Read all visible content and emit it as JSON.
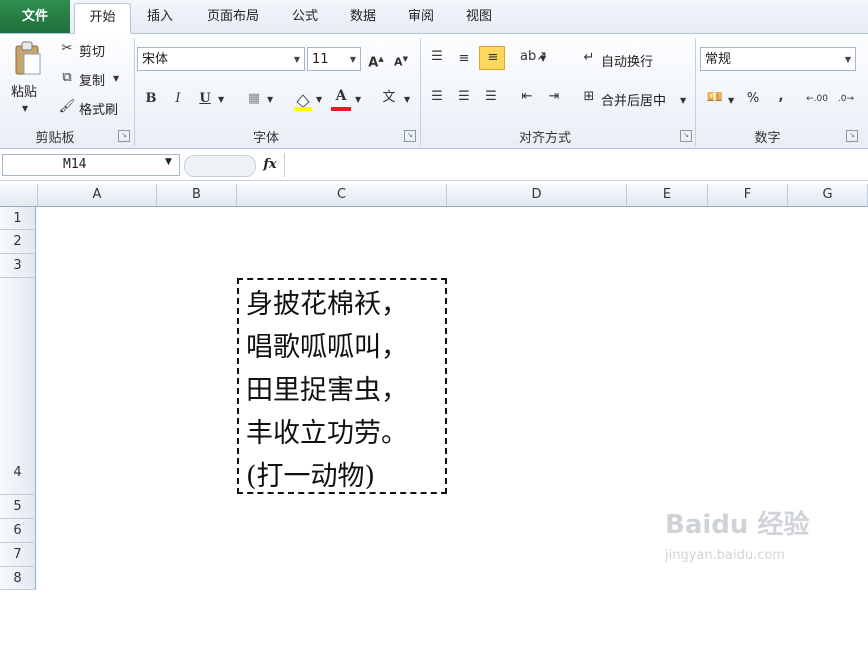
{
  "tabs": {
    "file": "文件",
    "home": "开始",
    "insert": "插入",
    "layout": "页面布局",
    "formula": "公式",
    "data": "数据",
    "review": "审阅",
    "view": "视图"
  },
  "clipboard": {
    "paste": "粘贴",
    "cut": "剪切",
    "copy": "复制",
    "format_painter": "格式刷",
    "label": "剪贴板"
  },
  "font": {
    "name": "宋体",
    "size": "11",
    "label": "字体",
    "bold": "B",
    "italic": "I",
    "underline": "U",
    "font_color_letter": "A",
    "font_color": "#e02020",
    "fill_color": "#ffff00"
  },
  "alignment": {
    "wrap_text": "自动换行",
    "merge_center": "合并后居中",
    "label": "对齐方式"
  },
  "number": {
    "format": "常规",
    "label": "数字",
    "percent": "%",
    "comma": ",",
    "inc_decimal": ".00",
    "dec_decimal": ".0"
  },
  "formula_bar": {
    "name_box": "M14",
    "fx": "fx",
    "value": ""
  },
  "columns": [
    "A",
    "B",
    "C",
    "D",
    "E",
    "F",
    "G"
  ],
  "rows": [
    "1",
    "2",
    "3",
    "4",
    "5",
    "6",
    "7",
    "8"
  ],
  "cell_C4": {
    "lines": [
      "身披花棉袄，",
      "唱歌呱呱叫，",
      "田里捉害虫，",
      "丰收立功劳。",
      "(打一动物)"
    ]
  },
  "watermark": {
    "brand": "Baidu 经验",
    "url": "jingyan.baidu.com"
  },
  "colors": {
    "ribbon_accent": "#ffd75a",
    "file_tab": "#217346"
  }
}
